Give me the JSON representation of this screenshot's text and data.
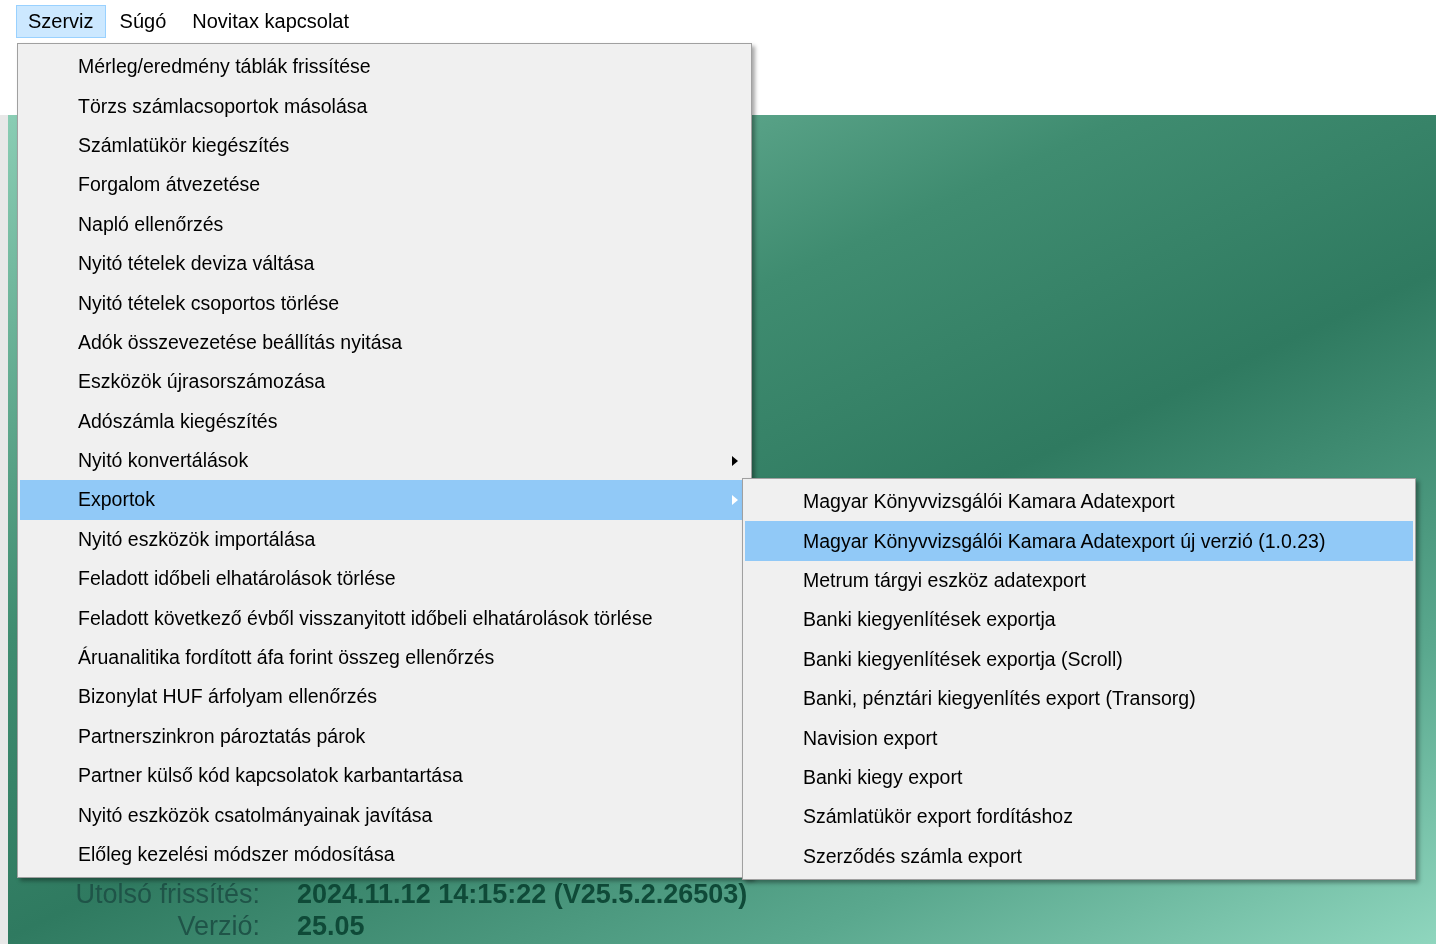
{
  "menubar": [
    {
      "label": "Szerviz",
      "selected": true
    },
    {
      "label": "Súgó",
      "selected": false
    },
    {
      "label": "Novitax kapcsolat",
      "selected": false
    }
  ],
  "info": [
    {
      "label": "Utolsó frissítés:",
      "value": "2024.11.12 14:15:22 (V25.5.2.26503)"
    },
    {
      "label": "Verzió:",
      "value": "25.05"
    }
  ],
  "menu": [
    {
      "label": "Mérleg/eredmény táblák frissítése",
      "submenu": false,
      "selected": false
    },
    {
      "label": "Törzs számlacsoportok másolása",
      "submenu": false,
      "selected": false
    },
    {
      "label": "Számlatükör kiegészítés",
      "submenu": false,
      "selected": false
    },
    {
      "label": "Forgalom átvezetése",
      "submenu": false,
      "selected": false
    },
    {
      "label": "Napló ellenőrzés",
      "submenu": false,
      "selected": false
    },
    {
      "label": "Nyitó tételek deviza váltása",
      "submenu": false,
      "selected": false
    },
    {
      "label": "Nyitó tételek csoportos törlése",
      "submenu": false,
      "selected": false
    },
    {
      "label": "Adók összevezetése beállítás nyitása",
      "submenu": false,
      "selected": false
    },
    {
      "label": "Eszközök újrasorszámozása",
      "submenu": false,
      "selected": false
    },
    {
      "label": "Adószámla kiegészítés",
      "submenu": false,
      "selected": false
    },
    {
      "label": "Nyitó konvertálások",
      "submenu": true,
      "selected": false
    },
    {
      "label": "Exportok",
      "submenu": true,
      "selected": true
    },
    {
      "label": "Nyitó eszközök importálása",
      "submenu": false,
      "selected": false
    },
    {
      "label": "Feladott időbeli elhatárolások törlése",
      "submenu": false,
      "selected": false
    },
    {
      "label": "Feladott következő évből visszanyitott időbeli elhatárolások törlése",
      "submenu": false,
      "selected": false
    },
    {
      "label": "Áruanalitika fordított áfa forint összeg ellenőrzés",
      "submenu": false,
      "selected": false
    },
    {
      "label": "Bizonylat HUF árfolyam ellenőrzés",
      "submenu": false,
      "selected": false
    },
    {
      "label": "Partnerszinkron pároztatás párok",
      "submenu": false,
      "selected": false
    },
    {
      "label": "Partner külső kód kapcsolatok karbantartása",
      "submenu": false,
      "selected": false
    },
    {
      "label": "Nyitó eszközök csatolmányainak javítása",
      "submenu": false,
      "selected": false
    },
    {
      "label": "Előleg kezelési módszer módosítása",
      "submenu": false,
      "selected": false
    }
  ],
  "submenu": [
    {
      "label": "Magyar Könyvvizsgálói Kamara Adatexport",
      "selected": false
    },
    {
      "label": "Magyar Könyvvizsgálói Kamara Adatexport új verzió (1.0.23)",
      "selected": true
    },
    {
      "label": "Metrum tárgyi eszköz adatexport",
      "selected": false
    },
    {
      "label": "Banki kiegyenlítések exportja",
      "selected": false
    },
    {
      "label": "Banki kiegyenlítések exportja (Scroll)",
      "selected": false
    },
    {
      "label": "Banki, pénztári kiegyenlítés export (Transorg)",
      "selected": false
    },
    {
      "label": "Navision export",
      "selected": false
    },
    {
      "label": "Banki kiegy export",
      "selected": false
    },
    {
      "label": "Számlatükör export fordításhoz",
      "selected": false
    },
    {
      "label": "Szerződés számla export",
      "selected": false
    }
  ]
}
